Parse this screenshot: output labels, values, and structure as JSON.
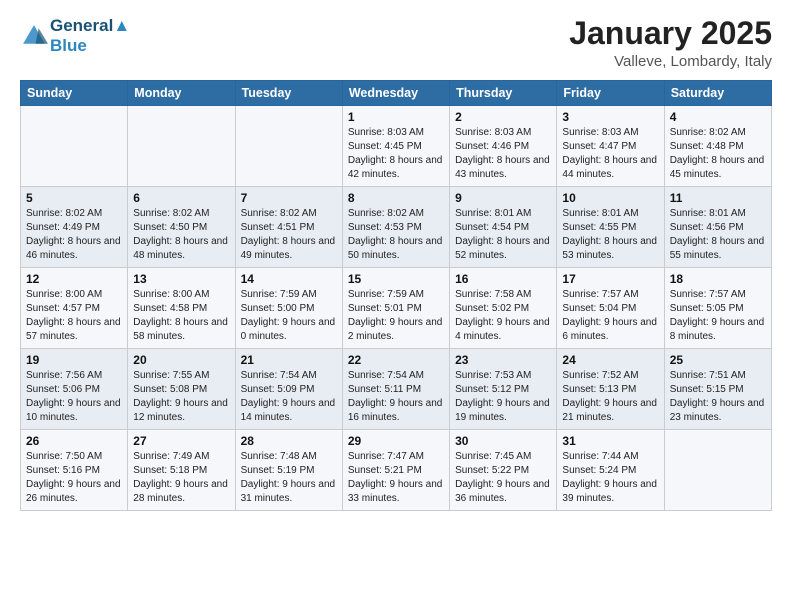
{
  "header": {
    "logo_line1": "General",
    "logo_line2": "Blue",
    "month": "January 2025",
    "location": "Valleve, Lombardy, Italy"
  },
  "weekdays": [
    "Sunday",
    "Monday",
    "Tuesday",
    "Wednesday",
    "Thursday",
    "Friday",
    "Saturday"
  ],
  "weeks": [
    [
      {
        "day": "",
        "info": ""
      },
      {
        "day": "",
        "info": ""
      },
      {
        "day": "",
        "info": ""
      },
      {
        "day": "1",
        "info": "Sunrise: 8:03 AM\nSunset: 4:45 PM\nDaylight: 8 hours and 42 minutes."
      },
      {
        "day": "2",
        "info": "Sunrise: 8:03 AM\nSunset: 4:46 PM\nDaylight: 8 hours and 43 minutes."
      },
      {
        "day": "3",
        "info": "Sunrise: 8:03 AM\nSunset: 4:47 PM\nDaylight: 8 hours and 44 minutes."
      },
      {
        "day": "4",
        "info": "Sunrise: 8:02 AM\nSunset: 4:48 PM\nDaylight: 8 hours and 45 minutes."
      }
    ],
    [
      {
        "day": "5",
        "info": "Sunrise: 8:02 AM\nSunset: 4:49 PM\nDaylight: 8 hours and 46 minutes."
      },
      {
        "day": "6",
        "info": "Sunrise: 8:02 AM\nSunset: 4:50 PM\nDaylight: 8 hours and 48 minutes."
      },
      {
        "day": "7",
        "info": "Sunrise: 8:02 AM\nSunset: 4:51 PM\nDaylight: 8 hours and 49 minutes."
      },
      {
        "day": "8",
        "info": "Sunrise: 8:02 AM\nSunset: 4:53 PM\nDaylight: 8 hours and 50 minutes."
      },
      {
        "day": "9",
        "info": "Sunrise: 8:01 AM\nSunset: 4:54 PM\nDaylight: 8 hours and 52 minutes."
      },
      {
        "day": "10",
        "info": "Sunrise: 8:01 AM\nSunset: 4:55 PM\nDaylight: 8 hours and 53 minutes."
      },
      {
        "day": "11",
        "info": "Sunrise: 8:01 AM\nSunset: 4:56 PM\nDaylight: 8 hours and 55 minutes."
      }
    ],
    [
      {
        "day": "12",
        "info": "Sunrise: 8:00 AM\nSunset: 4:57 PM\nDaylight: 8 hours and 57 minutes."
      },
      {
        "day": "13",
        "info": "Sunrise: 8:00 AM\nSunset: 4:58 PM\nDaylight: 8 hours and 58 minutes."
      },
      {
        "day": "14",
        "info": "Sunrise: 7:59 AM\nSunset: 5:00 PM\nDaylight: 9 hours and 0 minutes."
      },
      {
        "day": "15",
        "info": "Sunrise: 7:59 AM\nSunset: 5:01 PM\nDaylight: 9 hours and 2 minutes."
      },
      {
        "day": "16",
        "info": "Sunrise: 7:58 AM\nSunset: 5:02 PM\nDaylight: 9 hours and 4 minutes."
      },
      {
        "day": "17",
        "info": "Sunrise: 7:57 AM\nSunset: 5:04 PM\nDaylight: 9 hours and 6 minutes."
      },
      {
        "day": "18",
        "info": "Sunrise: 7:57 AM\nSunset: 5:05 PM\nDaylight: 9 hours and 8 minutes."
      }
    ],
    [
      {
        "day": "19",
        "info": "Sunrise: 7:56 AM\nSunset: 5:06 PM\nDaylight: 9 hours and 10 minutes."
      },
      {
        "day": "20",
        "info": "Sunrise: 7:55 AM\nSunset: 5:08 PM\nDaylight: 9 hours and 12 minutes."
      },
      {
        "day": "21",
        "info": "Sunrise: 7:54 AM\nSunset: 5:09 PM\nDaylight: 9 hours and 14 minutes."
      },
      {
        "day": "22",
        "info": "Sunrise: 7:54 AM\nSunset: 5:11 PM\nDaylight: 9 hours and 16 minutes."
      },
      {
        "day": "23",
        "info": "Sunrise: 7:53 AM\nSunset: 5:12 PM\nDaylight: 9 hours and 19 minutes."
      },
      {
        "day": "24",
        "info": "Sunrise: 7:52 AM\nSunset: 5:13 PM\nDaylight: 9 hours and 21 minutes."
      },
      {
        "day": "25",
        "info": "Sunrise: 7:51 AM\nSunset: 5:15 PM\nDaylight: 9 hours and 23 minutes."
      }
    ],
    [
      {
        "day": "26",
        "info": "Sunrise: 7:50 AM\nSunset: 5:16 PM\nDaylight: 9 hours and 26 minutes."
      },
      {
        "day": "27",
        "info": "Sunrise: 7:49 AM\nSunset: 5:18 PM\nDaylight: 9 hours and 28 minutes."
      },
      {
        "day": "28",
        "info": "Sunrise: 7:48 AM\nSunset: 5:19 PM\nDaylight: 9 hours and 31 minutes."
      },
      {
        "day": "29",
        "info": "Sunrise: 7:47 AM\nSunset: 5:21 PM\nDaylight: 9 hours and 33 minutes."
      },
      {
        "day": "30",
        "info": "Sunrise: 7:45 AM\nSunset: 5:22 PM\nDaylight: 9 hours and 36 minutes."
      },
      {
        "day": "31",
        "info": "Sunrise: 7:44 AM\nSunset: 5:24 PM\nDaylight: 9 hours and 39 minutes."
      },
      {
        "day": "",
        "info": ""
      }
    ]
  ]
}
